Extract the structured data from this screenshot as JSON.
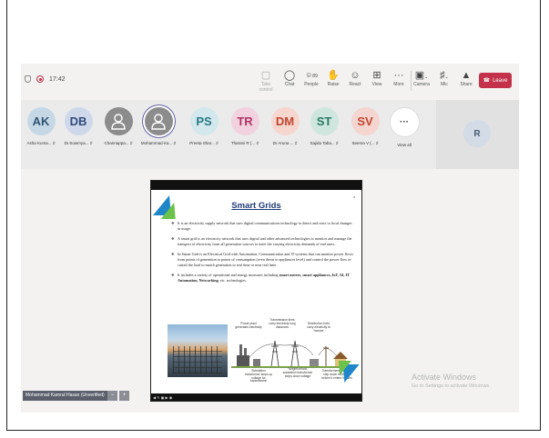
{
  "meeting": {
    "time": "17:42"
  },
  "toolbar": {
    "take_control": "Take control",
    "chat": "Chat",
    "people": "People",
    "people_count": "89",
    "raise": "Raise",
    "react": "React",
    "view": "View",
    "more": "More",
    "camera": "Camera",
    "mic": "Mic",
    "share": "Share",
    "leave": "Leave"
  },
  "participants": [
    {
      "initials": "AK",
      "name": "Asha Kuma...",
      "bg": "#c6d8e6",
      "fg": "#2f5573"
    },
    {
      "initials": "DB",
      "name": "Dr.Sowmya...",
      "bg": "#cfd8ea",
      "fg": "#2f4a7a"
    },
    {
      "initials": "",
      "name": "Channappa...",
      "bg": "#8c8c8c",
      "fg": "#ffffff",
      "icon": true
    },
    {
      "initials": "",
      "name": "Mohammad Ka...",
      "bg": "#8c8c8c",
      "fg": "#ffffff",
      "icon": true,
      "active": true
    },
    {
      "initials": "PS",
      "name": "Preeta Shar...",
      "bg": "#d3e8ec",
      "fg": "#2a7a8a"
    },
    {
      "initials": "TR",
      "name": "Tharani R (...",
      "bg": "#f1d2de",
      "fg": "#b03464"
    },
    {
      "initials": "DM",
      "name": "Dr Aruna ...",
      "bg": "#f6d6cf",
      "fg": "#c0472e"
    },
    {
      "initials": "ST",
      "name": "Sajida Taba...",
      "bg": "#cfe6df",
      "fg": "#2a7a62"
    },
    {
      "initials": "SV",
      "name": "Seema V (...",
      "bg": "#f5d5cf",
      "fg": "#c0472e"
    }
  ],
  "view_all": {
    "glyph": "···",
    "label": "View all"
  },
  "remote_tile": {
    "initials": "R"
  },
  "slide": {
    "title": "Smart Grids",
    "page": "4",
    "bullets": [
      "It is an electricity supply network that uses digital communications technology to detect and react to local changes in usage.",
      "A smart grid is an electricity network that uses digital and other advanced technologies to monitor and manage the transport of electricity from all generation sources to meet the varying electricity demands of end users.",
      "In Smart Grid is an Electrical Grid with Automation, Communication and IT systems that can monitor power flows from points of generation to points of consumption (even down to appliances level) and control the power flow or curtail the load to match generation to real time or near real time."
    ],
    "bullet4_pre": "It includes a variety of operational and energy measures including ",
    "bullet4_bold": "smart meters, smart appliances, IoT, AI, IT Automation, Networking",
    "bullet4_post": ", etc. technologies.",
    "diagram": {
      "power_plant": "Power plant generates electricity",
      "transmission": "Transmission lines carry electricity long distances",
      "distribution": "Distribution lines carry electricity to houses",
      "substation_up": "Substation transformer steps up voltage for transmission",
      "neighborhood": "Neighborhood substation transformer steps down voltage",
      "pole_transformer": "Transformers on poles step down electricity before it enters houses"
    }
  },
  "watermark": {
    "line1": "Activate Windows",
    "line2": "Go to Settings to activate Windows."
  },
  "presenter": {
    "name": "Mohammad Kamrul Hasan (Unverified)"
  }
}
